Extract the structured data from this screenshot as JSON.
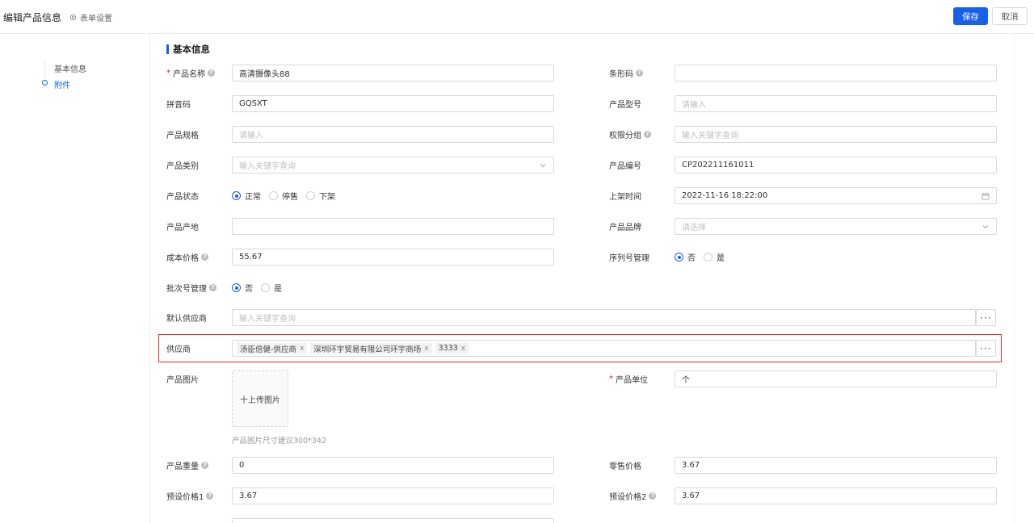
{
  "header": {
    "title": "编辑产品信息",
    "form_settings": "表单设置",
    "save": "保存",
    "cancel": "取消"
  },
  "anchor": {
    "items": [
      "基本信息",
      "附件"
    ],
    "active_index": 1
  },
  "section": {
    "title": "基本信息"
  },
  "fields": {
    "product_name": {
      "label": "产品名称",
      "value": "高清摄像头88"
    },
    "barcode": {
      "label": "条形码",
      "value": ""
    },
    "pinyin": {
      "label": "拼音码",
      "value": "GQSXT"
    },
    "model": {
      "label": "产品型号",
      "placeholder": "请输入"
    },
    "spec": {
      "label": "产品规格",
      "placeholder": "请输入"
    },
    "permission_group": {
      "label": "权限分组",
      "placeholder": "输入关键字查询"
    },
    "category": {
      "label": "产品类别",
      "placeholder": "输入关键字查询"
    },
    "code": {
      "label": "产品编号",
      "value": "CP202211161011"
    },
    "status": {
      "label": "产品状态",
      "options": [
        "正常",
        "停售",
        "下架"
      ],
      "selected": 0
    },
    "shelf_time": {
      "label": "上架时间",
      "value": "2022-11-16 18:22:00"
    },
    "origin": {
      "label": "产品产地",
      "value": ""
    },
    "brand": {
      "label": "产品品牌",
      "placeholder": "请选择"
    },
    "cost": {
      "label": "成本价格",
      "value": "55.67"
    },
    "serial_mgmt": {
      "label": "序列号管理",
      "options": [
        "否",
        "是"
      ],
      "selected": 0
    },
    "batch_mgmt": {
      "label": "批次号管理",
      "options": [
        "否",
        "是"
      ],
      "selected": 0
    },
    "default_supplier": {
      "label": "默认供应商",
      "placeholder": "输入关键字查询"
    },
    "supplier": {
      "label": "供应商",
      "tags": [
        "汤臣倍健-供应商",
        "深圳环宇贸易有限公司环宇商场",
        "3333"
      ]
    },
    "image": {
      "label": "产品图片",
      "upload": "十上传图片",
      "hint": "产品图片尺寸建议300*342"
    },
    "unit": {
      "label": "产品单位",
      "value": "个"
    },
    "weight": {
      "label": "产品重量",
      "value": "0"
    },
    "retail": {
      "label": "零售价格",
      "value": "3.67"
    },
    "preset1": {
      "label": "预设价格1",
      "value": "3.67"
    },
    "preset2": {
      "label": "预设价格2",
      "value": "3.67"
    }
  },
  "colors": {
    "primary": "#1960e8",
    "highlight": "#e0292b",
    "required": "#e02020"
  },
  "icons": [
    "gear-icon",
    "help-icon",
    "chevron-down-icon",
    "calendar-icon",
    "close-icon",
    "ellipsis-icon"
  ]
}
